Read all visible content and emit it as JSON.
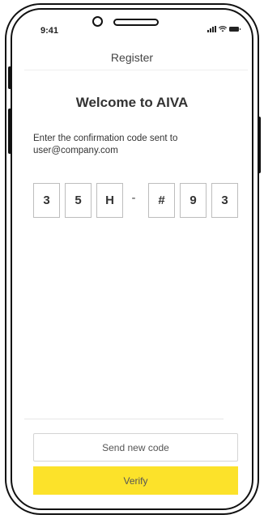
{
  "status_bar": {
    "time": "9:41",
    "icons": [
      "signal-icon",
      "wifi-icon",
      "battery-icon"
    ]
  },
  "header": {
    "title": "Register"
  },
  "main": {
    "welcome": "Welcome to AIVA",
    "instruction": "Enter the confirmation code sent to user@company.com",
    "code": {
      "digits": [
        "3",
        "5",
        "H",
        "#",
        "9",
        "3"
      ],
      "separator": "-"
    }
  },
  "actions": {
    "send_new_code": "Send new code",
    "verify": "Verify"
  },
  "colors": {
    "primary": "#fce22a",
    "border": "#bdbdbd",
    "text": "#333333"
  }
}
